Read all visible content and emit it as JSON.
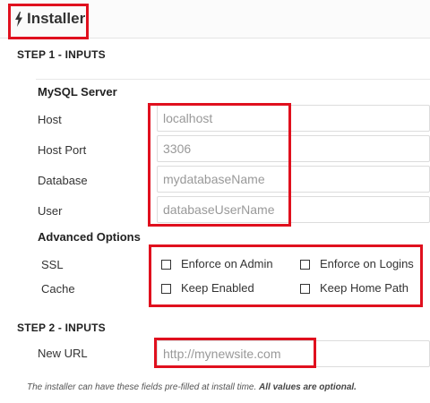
{
  "header": {
    "title": "Installer"
  },
  "step1": {
    "title": "STEP 1 - INPUTS",
    "mysql": {
      "heading": "MySQL Server",
      "host": {
        "label": "Host",
        "placeholder": "localhost"
      },
      "port": {
        "label": "Host Port",
        "placeholder": "3306"
      },
      "database": {
        "label": "Database",
        "placeholder": "mydatabaseName"
      },
      "user": {
        "label": "User",
        "placeholder": "databaseUserName"
      }
    },
    "advanced": {
      "heading": "Advanced Options",
      "ssl": {
        "label": "SSL",
        "opt1": "Enforce on Admin",
        "opt2": "Enforce on Logins"
      },
      "cache": {
        "label": "Cache",
        "opt1": "Keep Enabled",
        "opt2": "Keep Home Path"
      }
    }
  },
  "step2": {
    "title": "STEP 2 - INPUTS",
    "new_url": {
      "label": "New URL",
      "placeholder": "http://mynewsite.com"
    }
  },
  "footer": {
    "note": "The installer can have these fields pre-filled at install time.",
    "note_bold": "All values are optional."
  },
  "colors": {
    "highlight": "#e0101e"
  }
}
